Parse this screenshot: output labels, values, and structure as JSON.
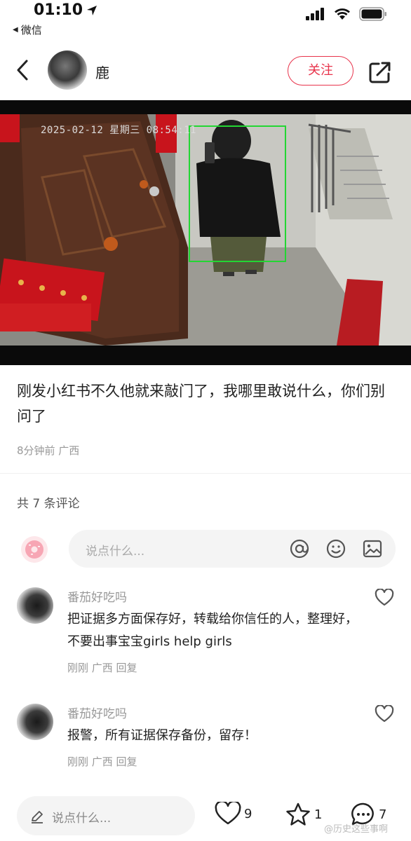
{
  "status_bar": {
    "time": "01:10",
    "back_app": "微信"
  },
  "header": {
    "author": "鹿",
    "follow": "关注"
  },
  "photo": {
    "timestamp": "2025-02-12 星期三 08:54:11"
  },
  "post": {
    "caption": "刚发小红书不久他就来敲门了，我哪里敢说什么，你们别问了",
    "meta": "8分钟前 广西"
  },
  "comments_section": {
    "count": "共 7 条评论",
    "input_placeholder": "说点什么..."
  },
  "comments": [
    {
      "name": "番茄好吃吗",
      "text": "把证据多方面保存好，转载给你信任的人，整理好，不要出事宝宝girls help girls",
      "meta": "刚刚 广西 回复"
    },
    {
      "name": "番茄好吃吗",
      "text": "报警，所有证据保存备份，留存！",
      "meta": "刚刚 广西 回复"
    }
  ],
  "bottom_bar": {
    "input_placeholder": "说点什么...",
    "likes": "9",
    "collects": "1",
    "comments": "7"
  },
  "watermark": "@历史这些事啊",
  "colors": {
    "accent": "#e8334b",
    "muted": "#999999"
  }
}
